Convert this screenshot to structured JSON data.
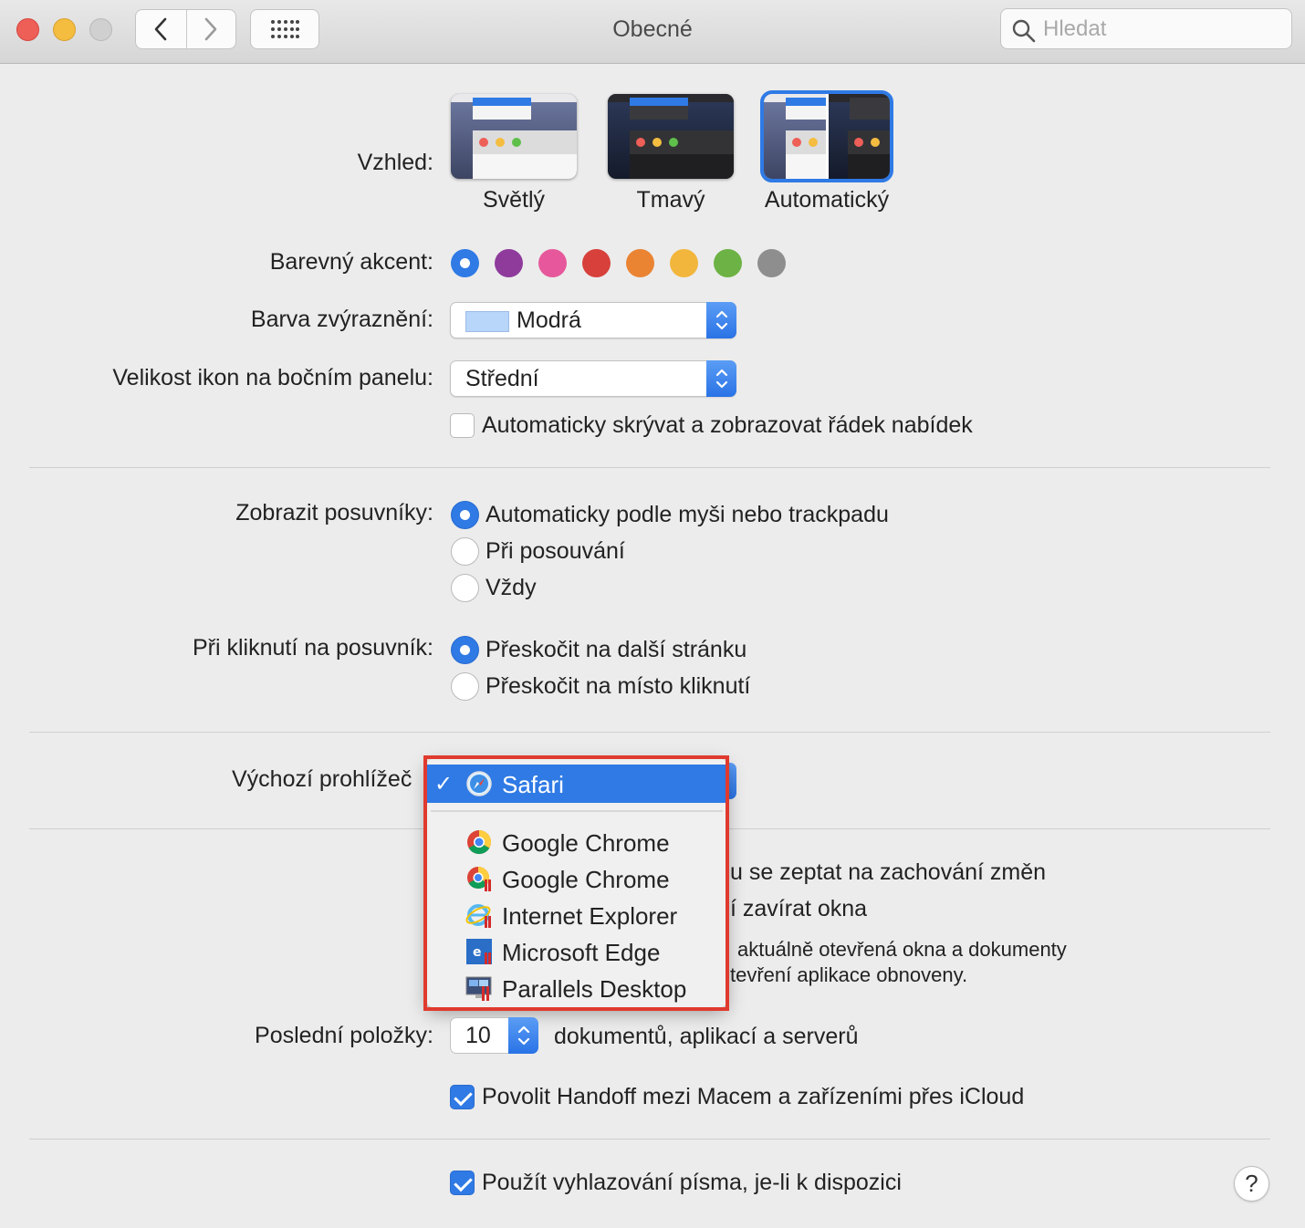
{
  "window": {
    "title": "Obecné",
    "search_placeholder": "Hledat"
  },
  "appearance": {
    "label": "Vzhled:",
    "options": [
      {
        "name": "Světlý",
        "selected": false
      },
      {
        "name": "Tmavý",
        "selected": false
      },
      {
        "name": "Automatický",
        "selected": true
      }
    ]
  },
  "accent": {
    "label": "Barevný akcent:",
    "colors": [
      "#2f7ae5",
      "#8e3b9c",
      "#e6589b",
      "#d7403b",
      "#ea8433",
      "#f2b63d",
      "#6cb244",
      "#8e8e8e"
    ],
    "selected_index": 0
  },
  "highlight": {
    "label": "Barva zvýraznění:",
    "value": "Modrá",
    "swatch": "#b8d5fa"
  },
  "sidebar_icon_size": {
    "label": "Velikost ikon na bočním panelu:",
    "value": "Střední"
  },
  "auto_hide_menu": {
    "label": "Automaticky skrývat a zobrazovat řádek nabídek",
    "checked": false
  },
  "scrollbars": {
    "label": "Zobrazit posuvníky:",
    "options": [
      "Automaticky podle myši nebo trackpadu",
      "Při posouvání",
      "Vždy"
    ],
    "selected_index": 0
  },
  "scroll_click": {
    "label": "Při kliknutí na posuvník:",
    "options": [
      "Přeskočit na další stránku",
      "Přeskočit na místo kliknutí"
    ],
    "selected_index": 0
  },
  "default_browser": {
    "label": "Výchozí prohlížeč",
    "menu": {
      "selected": "Safari",
      "items": [
        "Google Chrome",
        "Google Chrome",
        "Internet Explorer",
        "Microsoft Edge",
        "Parallels Desktop"
      ]
    }
  },
  "behind_menu_text": {
    "line1": "u se zeptat na zachování změn",
    "line2": "í zavírat okna",
    "line3": "aktuálně otevřená okna a dokumenty",
    "line4": "tevření aplikace obnoveny."
  },
  "recent_items": {
    "label": "Poslední položky:",
    "value": "10",
    "suffix": "dokumentů, aplikací a serverů"
  },
  "handoff": {
    "label": "Povolit Handoff mezi Macem a zařízeními přes iCloud",
    "checked": true
  },
  "font_smoothing": {
    "label": "Použít vyhlazování písma, je-li k dispozici",
    "checked": true
  },
  "help_label": "?"
}
